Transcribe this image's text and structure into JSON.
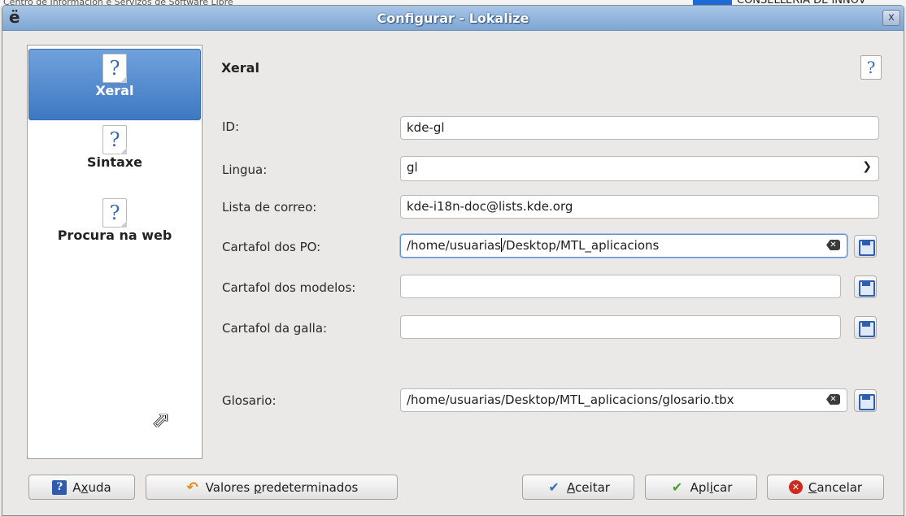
{
  "background": {
    "left_text": "Centro de Información e Servizos de Software Libre",
    "right_text": "CONSELLERÍA DE INNOV"
  },
  "window": {
    "title": "Configurar - Lokalize",
    "app_icon": "ë",
    "close_label": "x"
  },
  "sidebar": {
    "items": [
      {
        "label": "Xeral",
        "icon": "help-page-icon",
        "active": true
      },
      {
        "label": "Sintaxe",
        "icon": "help-page-icon",
        "active": false
      },
      {
        "label": "Procura na web",
        "icon": "help-page-icon",
        "active": false
      }
    ],
    "icon_glyph": "?"
  },
  "main": {
    "title": "Xeral",
    "help_glyph": "?",
    "fields": {
      "id": {
        "label": "ID:",
        "value": "kde-gl"
      },
      "language": {
        "label": "Lingua:",
        "value": "gl"
      },
      "mailing_list": {
        "label": "Lista de correo:",
        "value": "kde-i18n-doc@lists.kde.org"
      },
      "po_folder": {
        "label": "Cartafol dos PO:",
        "value_before_caret": "/home/usuarias",
        "value_after_caret": "/Desktop/MTL_aplicacions"
      },
      "templates_folder": {
        "label": "Cartafol dos modelos:",
        "value": ""
      },
      "branch_folder": {
        "label": "Cartafol da galla:",
        "value": ""
      },
      "glossary": {
        "label": "Glosario:",
        "value": "/home/usuarias/Desktop/MTL_aplicacions/glosario.tbx"
      }
    }
  },
  "buttons": {
    "help": {
      "pre": "A",
      "accel": "x",
      "post": "uda"
    },
    "defaults": {
      "pre": "Valores ",
      "accel": "p",
      "post": "redeterminados"
    },
    "ok": {
      "pre": "",
      "accel": "A",
      "post": "ceitar"
    },
    "apply": {
      "pre": "Apl",
      "accel": "i",
      "post": "car"
    },
    "cancel": {
      "pre": "",
      "accel": "C",
      "post": "ancelar"
    }
  },
  "colors": {
    "title_bar": "#7ea6d2",
    "selection": "#4a83c9",
    "accent_blue": "#2d5fae"
  }
}
